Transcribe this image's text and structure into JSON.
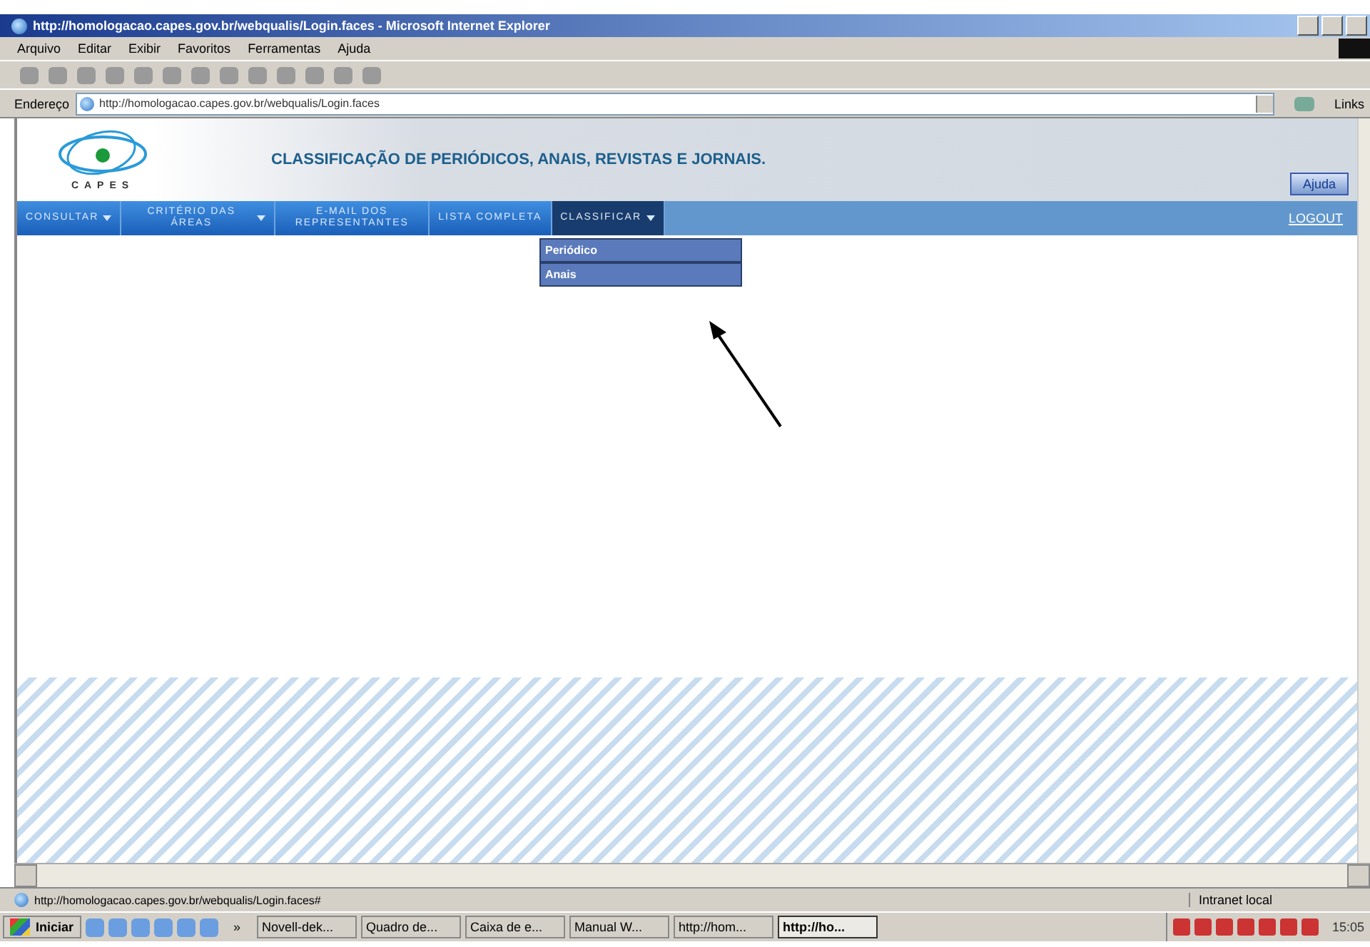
{
  "window": {
    "title": "http://homologacao.capes.gov.br/webqualis/Login.faces - Microsoft Internet Explorer"
  },
  "menu": [
    "Arquivo",
    "Editar",
    "Exibir",
    "Favoritos",
    "Ferramentas",
    "Ajuda"
  ],
  "address_bar": {
    "label": "Endereço",
    "value": "http://homologacao.capes.gov.br/webqualis/Login.faces",
    "links": "Links"
  },
  "page": {
    "logo_text": "CAPES",
    "heading": "CLASSIFICAÇÃO DE PERIÓDICOS, ANAIS, REVISTAS E JORNAIS.",
    "help_button": "Ajuda",
    "nav": [
      {
        "label": "CONSULTAR",
        "caret": true,
        "selected": false
      },
      {
        "label": "CRITÉRIO DAS ÁREAS",
        "caret": true,
        "selected": false
      },
      {
        "label": "E-MAIL DOS REPRESENTANTES",
        "caret": false,
        "selected": false
      },
      {
        "label": "LISTA COMPLETA",
        "caret": false,
        "selected": false
      },
      {
        "label": "CLASSIFICAR",
        "caret": true,
        "selected": true
      }
    ],
    "logout": "LOGOUT",
    "dropdown": [
      "Periódico",
      "Anais"
    ]
  },
  "status_bar": {
    "text": "http://homologacao.capes.gov.br/webqualis/Login.faces#",
    "zone": "Intranet local"
  },
  "taskbar": {
    "start": "Iniciar",
    "more": "»",
    "tasks": [
      {
        "label": "Novell-dek...",
        "selected": false
      },
      {
        "label": "Quadro de...",
        "selected": false
      },
      {
        "label": "Caixa de e...",
        "selected": false
      },
      {
        "label": "Manual W...",
        "selected": false
      },
      {
        "label": "http://hom...",
        "selected": false
      },
      {
        "label": "http://ho...",
        "selected": true
      }
    ],
    "clock": "15:05"
  }
}
